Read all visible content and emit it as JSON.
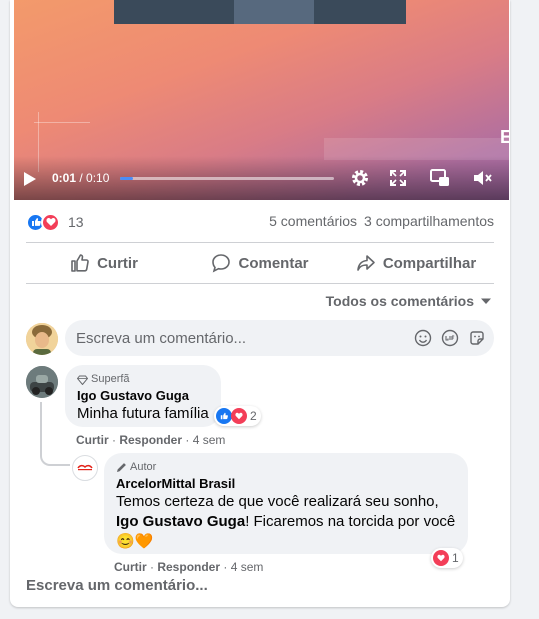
{
  "video": {
    "current_time": "0:01",
    "separator": " / ",
    "duration": "0:10",
    "progress_fraction": 0.06,
    "edge_letter": "E"
  },
  "reactions": {
    "count": "13",
    "comments": "5 comentários",
    "shares": "3 compartilhamentos"
  },
  "actions": {
    "like": "Curtir",
    "comment": "Comentar",
    "share": "Compartilhar"
  },
  "filter": {
    "label": "Todos os comentários"
  },
  "composer": {
    "placeholder": "Escreva um comentário..."
  },
  "comments": [
    {
      "badge": "Superfã",
      "author": "Igo Gustavo Guga",
      "text": "Minha futura família",
      "reaction_count": "2",
      "like_label": "Curtir",
      "reply_label": "Responder",
      "time": "4 sem"
    },
    {
      "badge": "Autor",
      "author": "ArcelorMittal Brasil",
      "text_line1": "Temos certeza de que você realizará seu sonho,",
      "mention": "Igo Gustavo Guga",
      "text_line2": "! Ficaremos na torcida por você",
      "emoji": "😊🧡",
      "reaction_count": "1",
      "like_label": "Curtir",
      "reply_label": "Responder",
      "time": "4 sem"
    }
  ],
  "footer": {
    "write_more": "Escreva um comentário..."
  },
  "colors": {
    "accent": "#1877f2",
    "love": "#f33e58",
    "muted_text": "#65676b",
    "bubble_bg": "#f0f2f5"
  }
}
